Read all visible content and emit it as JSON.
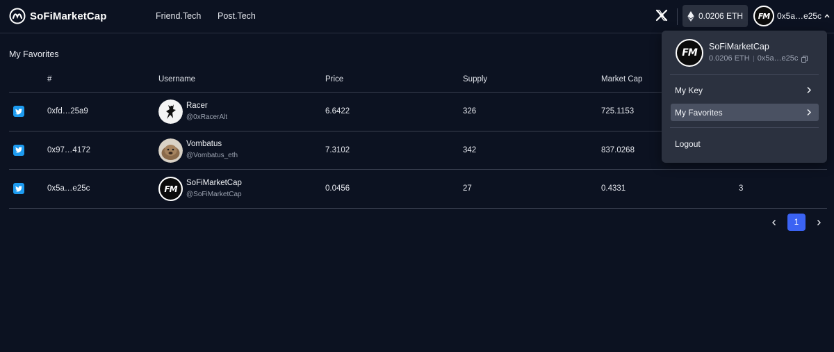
{
  "header": {
    "brand": "SoFiMarketCap",
    "nav": [
      "Friend.Tech",
      "Post.Tech"
    ],
    "eth_balance": "0.0206 ETH",
    "account_short": "0x5a…e25c"
  },
  "page": {
    "title": "My Favorites"
  },
  "table": {
    "columns": [
      "#",
      "Username",
      "Price",
      "Supply",
      "Market Cap"
    ],
    "rows": [
      {
        "addr": "0xfd…25a9",
        "name": "Racer",
        "handle": "@0xRacerAlt",
        "price": "6.6422",
        "supply": "326",
        "mcap": "725.1153",
        "extra": ""
      },
      {
        "addr": "0x97…4172",
        "name": "Vombatus",
        "handle": "@Vombatus_eth",
        "price": "7.3102",
        "supply": "342",
        "mcap": "837.0268",
        "extra": ""
      },
      {
        "addr": "0x5a…e25c",
        "name": "SoFiMarketCap",
        "handle": "@SoFiMarketCap",
        "price": "0.0456",
        "supply": "27",
        "mcap": "0.4331",
        "extra": "3"
      }
    ]
  },
  "pagination": {
    "current": "1"
  },
  "dropdown": {
    "name": "SoFiMarketCap",
    "eth": "0.0206 ETH",
    "address": "0x5a…e25c",
    "items": [
      "My Key",
      "My Favorites",
      "Logout"
    ],
    "avatar_text": "FM"
  },
  "colors": {
    "background": "#0c1221",
    "accent": "#3b63f3",
    "twitter": "#1d9bf0",
    "dropdown": "#2b313f"
  }
}
